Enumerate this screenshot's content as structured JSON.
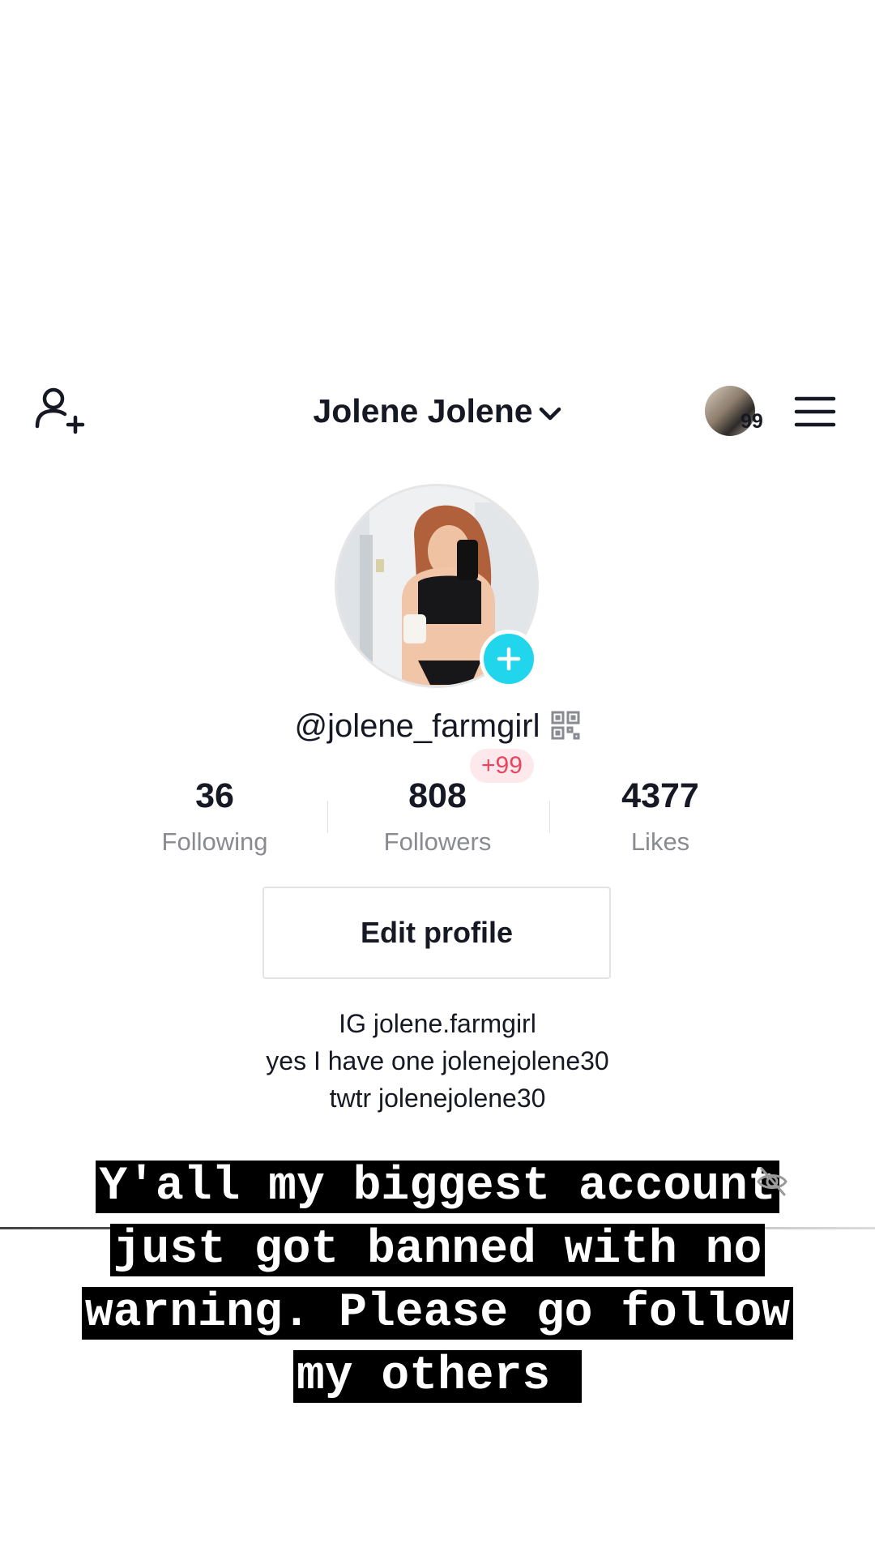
{
  "header": {
    "title": "Jolene Jolene",
    "notification_count": "99"
  },
  "profile": {
    "username": "@jolene_farmgirl",
    "new_followers_badge": "+99",
    "stats": [
      {
        "value": "36",
        "label": "Following"
      },
      {
        "value": "808",
        "label": "Followers"
      },
      {
        "value": "4377",
        "label": "Likes"
      }
    ],
    "edit_button": "Edit profile",
    "bio": [
      "IG jolene.farmgirl",
      "yes I have one jolenejolene30",
      "twtr jolenejolene30"
    ]
  },
  "caption": {
    "lines": [
      "Y'all my biggest account",
      "just got banned with no",
      "warning. Please go follow",
      "my others "
    ]
  },
  "colors": {
    "accent": "#20d5ec",
    "badge_text": "#e94560",
    "badge_bg": "#fde8eb",
    "caption_bg": "#000000"
  }
}
